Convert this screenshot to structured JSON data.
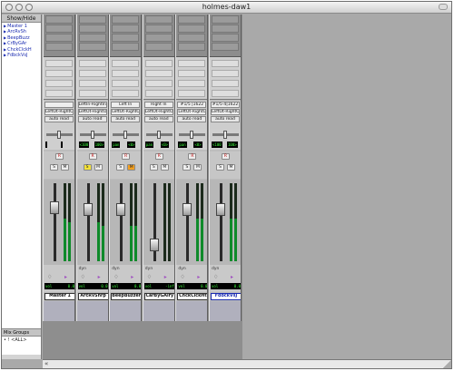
{
  "window": {
    "title": "holmes-daw1"
  },
  "sidebar": {
    "header": "Show/Hide",
    "tracks": [
      "Master 1",
      "ArcRvSh",
      "BeepBuzz",
      "CrByGAr",
      "ChckClckH",
      "FdbckVsJ"
    ],
    "mix_groups_header": "Mix Groups",
    "mix_groups_row": "<ALL>",
    "mix_groups_prefix": "• !"
  },
  "strips": [
    {
      "name": "Master 1",
      "input": "",
      "output": "LeftOt-RightOt",
      "auto": "auto read",
      "pan_l": "",
      "pan_r": "",
      "dyn": "",
      "vol": "0.0",
      "selected": false,
      "level_l": 0.55,
      "level_r": 0.5,
      "fader": 0.72,
      "s_on": false,
      "m_on": false
    },
    {
      "name": "ArcRvShrp",
      "input": "LeftIn-RightIn",
      "output": "LeftOt-RightOt",
      "auto": "auto read",
      "pan_l": "<100",
      "pan_r": "100>",
      "dyn": "dyn",
      "vol": "0.0",
      "selected": false,
      "level_l": 0.5,
      "level_r": 0.45,
      "fader": 0.7,
      "s_on": true,
      "m_on": false
    },
    {
      "name": "BeepBuzzer",
      "input": "Left In",
      "output": "LeftOt-RightOt",
      "auto": "auto read",
      "pan_l": "pan",
      "pan_r": "<0>",
      "dyn": "dyn",
      "vol": "0.0",
      "selected": false,
      "level_l": 0.45,
      "level_r": 0.45,
      "fader": 0.7,
      "s_on": false,
      "m_on": true
    },
    {
      "name": "CarByGAiry",
      "input": "Right In",
      "output": "LeftOt-RightOt",
      "auto": "auto read",
      "pan_l": "pan",
      "pan_r": "<0>",
      "dyn": "dyn",
      "vol": "-inf",
      "selected": false,
      "level_l": 0.0,
      "level_r": 0.0,
      "fader": 0.15,
      "s_on": false,
      "m_on": false
    },
    {
      "name": "ChckClckHt",
      "input": "#1/5 |1622",
      "output": "LeftOt-RightOt",
      "auto": "auto read",
      "pan_l": "pan",
      "pan_r": "<0>",
      "dyn": "dyn",
      "vol": "0.0",
      "selected": false,
      "level_l": 0.55,
      "level_r": 0.55,
      "fader": 0.7,
      "s_on": false,
      "m_on": false
    },
    {
      "name": "FdbckVsJ",
      "input": "#1/5-4|1622",
      "output": "LeftOt-RightOt",
      "auto": "auto read",
      "pan_l": "<100",
      "pan_r": "100>",
      "dyn": "dyn",
      "vol": "0.0",
      "selected": true,
      "level_l": 0.55,
      "level_r": 0.55,
      "fader": 0.7,
      "s_on": false,
      "m_on": false
    }
  ],
  "labels": {
    "r": "R",
    "s": "S",
    "m": "M",
    "rec_icon": "record-icon"
  }
}
